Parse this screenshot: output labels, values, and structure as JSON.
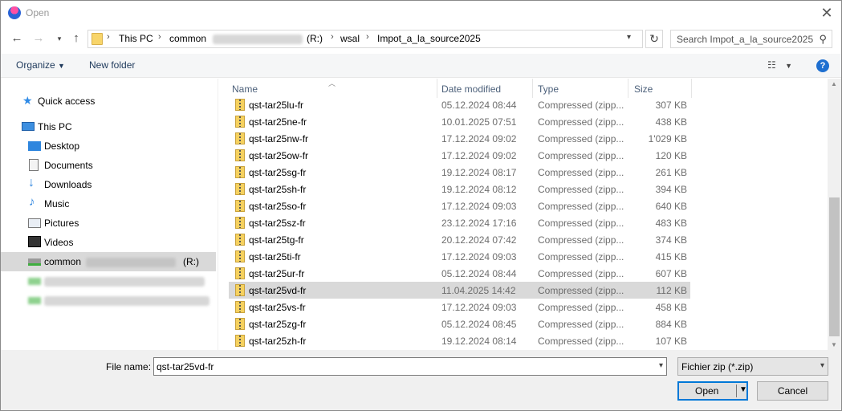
{
  "window": {
    "title": "Open"
  },
  "address": {
    "crumbs": [
      "This PC",
      "common",
      "(R:)",
      "wsal",
      "Impot_a_la_source2025"
    ]
  },
  "search": {
    "placeholder": "Search Impot_a_la_source2025"
  },
  "toolbar": {
    "organize": "Organize",
    "new_folder": "New folder",
    "help": "?"
  },
  "sidebar": {
    "items": [
      {
        "label": "Quick access",
        "icon": "star-icon"
      },
      {
        "label": "This PC",
        "icon": "computer-icon"
      },
      {
        "label": "Desktop",
        "icon": "desktop-icon"
      },
      {
        "label": "Documents",
        "icon": "documents-icon"
      },
      {
        "label": "Downloads",
        "icon": "downloads-icon"
      },
      {
        "label": "Music",
        "icon": "music-icon"
      },
      {
        "label": "Pictures",
        "icon": "pictures-icon"
      },
      {
        "label": "Videos",
        "icon": "videos-icon"
      },
      {
        "label": "common",
        "suffix": "(R:)",
        "icon": "network-drive-icon"
      }
    ]
  },
  "columns": {
    "name": "Name",
    "date": "Date modified",
    "type": "Type",
    "size": "Size"
  },
  "files": [
    {
      "name": "qst-tar25lu-fr",
      "date": "05.12.2024 08:44",
      "type": "Compressed (zipp...",
      "size": "307 KB"
    },
    {
      "name": "qst-tar25ne-fr",
      "date": "10.01.2025 07:51",
      "type": "Compressed (zipp...",
      "size": "438 KB"
    },
    {
      "name": "qst-tar25nw-fr",
      "date": "17.12.2024 09:02",
      "type": "Compressed (zipp...",
      "size": "1'029 KB"
    },
    {
      "name": "qst-tar25ow-fr",
      "date": "17.12.2024 09:02",
      "type": "Compressed (zipp...",
      "size": "120 KB"
    },
    {
      "name": "qst-tar25sg-fr",
      "date": "19.12.2024 08:17",
      "type": "Compressed (zipp...",
      "size": "261 KB"
    },
    {
      "name": "qst-tar25sh-fr",
      "date": "19.12.2024 08:12",
      "type": "Compressed (zipp...",
      "size": "394 KB"
    },
    {
      "name": "qst-tar25so-fr",
      "date": "17.12.2024 09:03",
      "type": "Compressed (zipp...",
      "size": "640 KB"
    },
    {
      "name": "qst-tar25sz-fr",
      "date": "23.12.2024 17:16",
      "type": "Compressed (zipp...",
      "size": "483 KB"
    },
    {
      "name": "qst-tar25tg-fr",
      "date": "20.12.2024 07:42",
      "type": "Compressed (zipp...",
      "size": "374 KB"
    },
    {
      "name": "qst-tar25ti-fr",
      "date": "17.12.2024 09:03",
      "type": "Compressed (zipp...",
      "size": "415 KB"
    },
    {
      "name": "qst-tar25ur-fr",
      "date": "05.12.2024 08:44",
      "type": "Compressed (zipp...",
      "size": "607 KB"
    },
    {
      "name": "qst-tar25vd-fr",
      "date": "11.04.2025 14:42",
      "type": "Compressed (zipp...",
      "size": "112 KB",
      "selected": true
    },
    {
      "name": "qst-tar25vs-fr",
      "date": "17.12.2024 09:03",
      "type": "Compressed (zipp...",
      "size": "458 KB"
    },
    {
      "name": "qst-tar25zg-fr",
      "date": "05.12.2024 08:45",
      "type": "Compressed (zipp...",
      "size": "884 KB"
    },
    {
      "name": "qst-tar25zh-fr",
      "date": "19.12.2024 08:14",
      "type": "Compressed (zipp...",
      "size": "107 KB"
    }
  ],
  "bottom": {
    "file_name_label": "File name:",
    "file_name_value": "qst-tar25vd-fr",
    "file_type": "Fichier zip (*.zip)",
    "open_label": "Open",
    "cancel_label": "Cancel"
  },
  "colors": {
    "accent": "#0078d7",
    "selection": "#d9d9d9",
    "link": "#1e395b"
  }
}
